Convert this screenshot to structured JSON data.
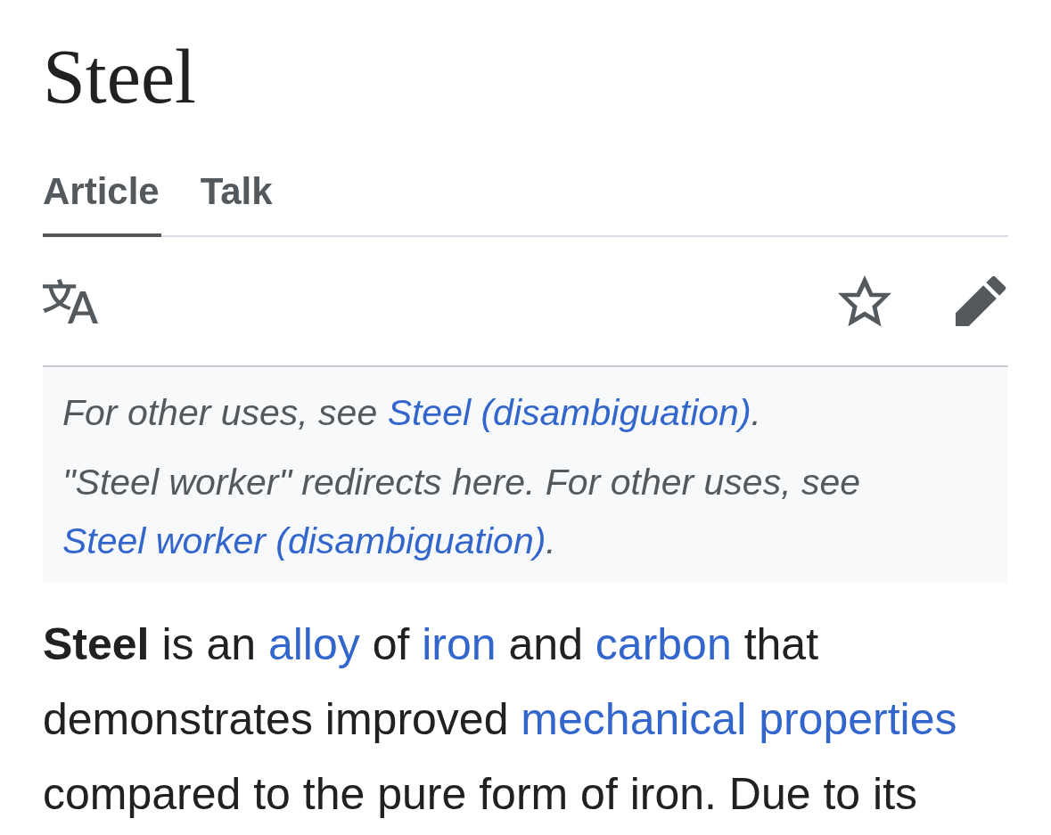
{
  "title": "Steel",
  "tabs": [
    {
      "label": "Article",
      "selected": true
    },
    {
      "label": "Talk",
      "selected": false
    }
  ],
  "toolbar": {
    "watched": false
  },
  "hatnotes": [
    [
      {
        "kind": "text",
        "text": "For other uses, see "
      },
      {
        "kind": "link",
        "text": "Steel (disambiguation)"
      },
      {
        "kind": "text",
        "text": "."
      }
    ],
    [
      {
        "kind": "text",
        "text": "\"Steel worker\" redirects here. For other uses, see "
      },
      {
        "kind": "link",
        "text": "Steel worker (disambiguation)"
      },
      {
        "kind": "text",
        "text": "."
      }
    ]
  ],
  "paragraph": [
    {
      "kind": "bold",
      "text": "Steel"
    },
    {
      "kind": "text",
      "text": " is an "
    },
    {
      "kind": "link",
      "text": "alloy"
    },
    {
      "kind": "text",
      "text": " of "
    },
    {
      "kind": "link",
      "text": "iron"
    },
    {
      "kind": "text",
      "text": " and "
    },
    {
      "kind": "link",
      "text": "carbon"
    },
    {
      "kind": "text",
      "text": " that demonstrates improved "
    },
    {
      "kind": "link",
      "text": "mechanical properties"
    },
    {
      "kind": "text",
      "text": " compared to the pure form of iron. Due to its"
    }
  ]
}
